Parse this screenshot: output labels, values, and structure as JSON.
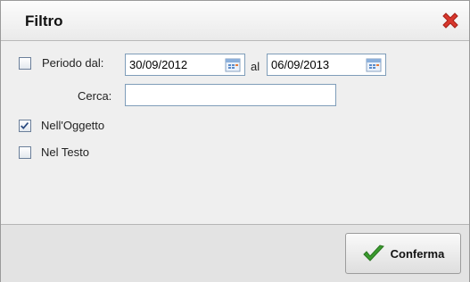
{
  "dialog": {
    "title": "Filtro",
    "close_icon": "close-x-icon"
  },
  "filters": {
    "period": {
      "checked": false,
      "label": "Periodo dal:",
      "from_value": "30/09/2012",
      "to_label": "al",
      "to_value": "06/09/2013",
      "calendar_icon": "calendar-icon"
    },
    "search": {
      "label": "Cerca:",
      "value": ""
    },
    "in_subject": {
      "checked": true,
      "label": "Nell'Oggetto"
    },
    "in_text": {
      "checked": false,
      "label": "Nel Testo"
    }
  },
  "footer": {
    "confirm_label": "Conferma",
    "confirm_icon": "checkmark-icon"
  },
  "colors": {
    "close_red": "#d8382e",
    "check_green": "#3a9b2e",
    "input_border": "#7f9db9"
  }
}
